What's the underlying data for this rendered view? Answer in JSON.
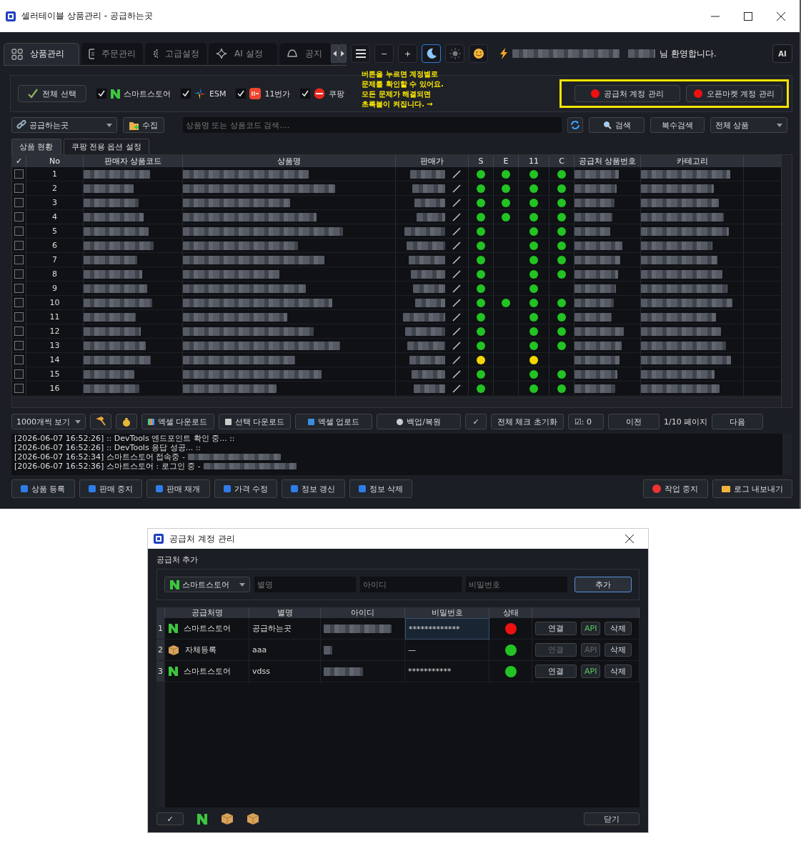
{
  "window": {
    "title": "셀러테이블 상품관리 - 공급하는곳"
  },
  "tabs": [
    {
      "label": "상품관리",
      "selected": true
    },
    {
      "label": "주문관리",
      "selected": false
    },
    {
      "label": "고급설정",
      "selected": false
    },
    {
      "label": "AI 설정",
      "selected": false
    },
    {
      "label": "공지",
      "selected": false
    }
  ],
  "zoom_buttons": [
    "−",
    "+"
  ],
  "theme_buttons": [
    {
      "selected": true
    },
    {
      "selected": false
    },
    {
      "selected": false
    }
  ],
  "welcome": "님 환영합니다.",
  "ai_button": "AI",
  "markets": {
    "select_all": "전체 선택",
    "items": [
      {
        "label": "스마트스토어",
        "checked": true
      },
      {
        "label": "ESM",
        "checked": true
      },
      {
        "label": "11번가",
        "checked": true
      },
      {
        "label": "쿠팡",
        "checked": true
      }
    ]
  },
  "notice": "버튼을 누르면 계정별로\n문제를 확인할 수 있어요.\n모든 문제가 해결되면\n초록불이 켜집니다.  →",
  "account_buttons": [
    {
      "label": "공급처 계정 관리",
      "color": "#ee1111"
    },
    {
      "label": "오픈마켓 계정 관리",
      "color": "#ee1111"
    }
  ],
  "search": {
    "supplier": "공급하는곳",
    "collect": "수집",
    "placeholder": "상품명 또는 상품코드 검색....",
    "search": "검색",
    "multi": "복수검색",
    "filter": "전체 상품"
  },
  "subtabs": [
    {
      "label": "상품 현황",
      "selected": true
    },
    {
      "label": "쿠팡 전용 옵션 설정",
      "selected": false
    }
  ],
  "table": {
    "columns": [
      "✓",
      "No",
      "판매자 상품코드",
      "상품명",
      "판매가",
      "S",
      "E",
      "11",
      "C",
      "공급처 상품번호",
      "카테고리"
    ],
    "rows": [
      {
        "no": "1",
        "checked": false,
        "dots": {
          "s": {
            "color": "#22c322"
          },
          "e": {
            "color": "#22c322"
          },
          "m11": {
            "color": "#22c322"
          },
          "c": {
            "color": "#22c322"
          }
        }
      },
      {
        "no": "2",
        "checked": false,
        "dots": {
          "s": {
            "color": "#22c322"
          },
          "e": {
            "color": "#22c322"
          },
          "m11": {
            "color": "#22c322"
          },
          "c": {
            "color": "#22c322"
          }
        }
      },
      {
        "no": "3",
        "checked": false,
        "dots": {
          "s": {
            "color": "#22c322"
          },
          "e": {
            "color": "#22c322"
          },
          "m11": {
            "color": "#22c322"
          },
          "c": {
            "color": "#22c322"
          }
        }
      },
      {
        "no": "4",
        "checked": false,
        "dots": {
          "s": {
            "color": "#22c322"
          },
          "e": {
            "color": "#22c322"
          },
          "m11": {
            "color": "#22c322"
          },
          "c": {
            "color": "#22c322"
          }
        }
      },
      {
        "no": "5",
        "checked": false,
        "dots": {
          "s": {
            "color": "#22c322"
          },
          "m11": {
            "color": "#22c322"
          },
          "c": {
            "color": "#22c322"
          }
        }
      },
      {
        "no": "6",
        "checked": false,
        "dots": {
          "s": {
            "color": "#22c322"
          },
          "m11": {
            "color": "#22c322"
          },
          "c": {
            "color": "#22c322"
          }
        }
      },
      {
        "no": "7",
        "checked": false,
        "dots": {
          "s": {
            "color": "#22c322"
          },
          "m11": {
            "color": "#22c322"
          },
          "c": {
            "color": "#22c322"
          }
        }
      },
      {
        "no": "8",
        "checked": false,
        "dots": {
          "s": {
            "color": "#22c322"
          },
          "m11": {
            "color": "#22c322"
          },
          "c": {
            "color": "#22c322"
          }
        }
      },
      {
        "no": "9",
        "checked": false,
        "dots": {
          "s": {
            "color": "#22c322"
          },
          "m11": {
            "color": "#22c322"
          }
        }
      },
      {
        "no": "10",
        "checked": false,
        "dots": {
          "s": {
            "color": "#22c322"
          },
          "e": {
            "color": "#22c322"
          },
          "m11": {
            "color": "#22c322"
          },
          "c": {
            "color": "#22c322"
          }
        }
      },
      {
        "no": "11",
        "checked": false,
        "dots": {
          "s": {
            "color": "#22c322"
          },
          "m11": {
            "color": "#22c322"
          },
          "c": {
            "color": "#22c322"
          }
        }
      },
      {
        "no": "12",
        "checked": false,
        "dots": {
          "s": {
            "color": "#22c322"
          },
          "m11": {
            "color": "#22c322"
          },
          "c": {
            "color": "#22c322"
          }
        }
      },
      {
        "no": "13",
        "checked": false,
        "dots": {
          "s": {
            "color": "#22c322"
          },
          "m11": {
            "color": "#22c322"
          },
          "c": {
            "color": "#22c322"
          }
        }
      },
      {
        "no": "14",
        "checked": false,
        "dots": {
          "s": {
            "color": "#f2d600"
          },
          "m11": {
            "color": "#f2d600"
          }
        }
      },
      {
        "no": "15",
        "checked": false,
        "dots": {
          "s": {
            "color": "#22c322"
          },
          "m11": {
            "color": "#22c322"
          },
          "c": {
            "color": "#22c322"
          }
        }
      },
      {
        "no": "16",
        "checked": false,
        "dots": {
          "s": {
            "color": "#22c322"
          },
          "m11": {
            "color": "#22c322"
          },
          "c": {
            "color": "#22c322"
          }
        }
      }
    ]
  },
  "bottom_toolbar": {
    "page_size": "1000개씩 보기",
    "buttons": [
      "엑셀 다운로드",
      "선택 다운로드",
      "엑셀 업로드",
      "백업/복원"
    ],
    "check": "✓",
    "reset": "전체 체크 초기화",
    "count": "☑: 0",
    "prev": "이전",
    "page": "1/10 페이지",
    "next": "다음"
  },
  "log": [
    "[2026-06-07 16:52:26] :: DevTools 엔드포인트 확인 중... ::",
    "[2026-06-07 16:52:26] :: DevTools 응답 성공... ::",
    "[2026-06-07 16:52:34] 스마트스토어 접속중 -",
    "[2026-06-07 16:52:36] 스마트스토어 : 로그인 중 -"
  ],
  "actions": {
    "left": [
      "상품 등록",
      "판매 중지",
      "판매 재개",
      "가격 수정",
      "정보 갱신",
      "정보 삭제"
    ],
    "right": [
      "작업 중지",
      "로그 내보내기"
    ]
  },
  "dialog": {
    "title": "공급처 계정 관리",
    "section": "공급처 추가",
    "market": "스마트스토어",
    "alias_placeholder": "별명",
    "id_placeholder": "아이디",
    "password_placeholder": "비밀번호",
    "add": "추가",
    "columns": [
      "공급처명",
      "별명",
      "아이디",
      "비밀번호",
      "상태"
    ],
    "rows": [
      {
        "index": "1",
        "kind": "naver",
        "market": "스마트스토어",
        "alias": "공급하는곳",
        "password": "*************",
        "password_selected": true,
        "color": "#ee1111",
        "connect": "연결",
        "connect_disabled": false,
        "api": "API",
        "api_disabled": false,
        "delete": "삭제"
      },
      {
        "index": "2",
        "kind": "self",
        "market": "자체등록",
        "alias": "aaa",
        "password": "—",
        "password_selected": false,
        "color": "#22c322",
        "connect": "연결",
        "connect_disabled": true,
        "api": "API",
        "api_disabled": true,
        "delete": "삭제"
      },
      {
        "index": "3",
        "kind": "naver",
        "market": "스마트스토어",
        "alias": "vdss",
        "password": "***********",
        "password_selected": false,
        "color": "#22c322",
        "connect": "연결",
        "connect_disabled": false,
        "api": "API",
        "api_disabled": false,
        "delete": "삭제"
      }
    ],
    "footer_check": "✓",
    "close": "닫기"
  }
}
